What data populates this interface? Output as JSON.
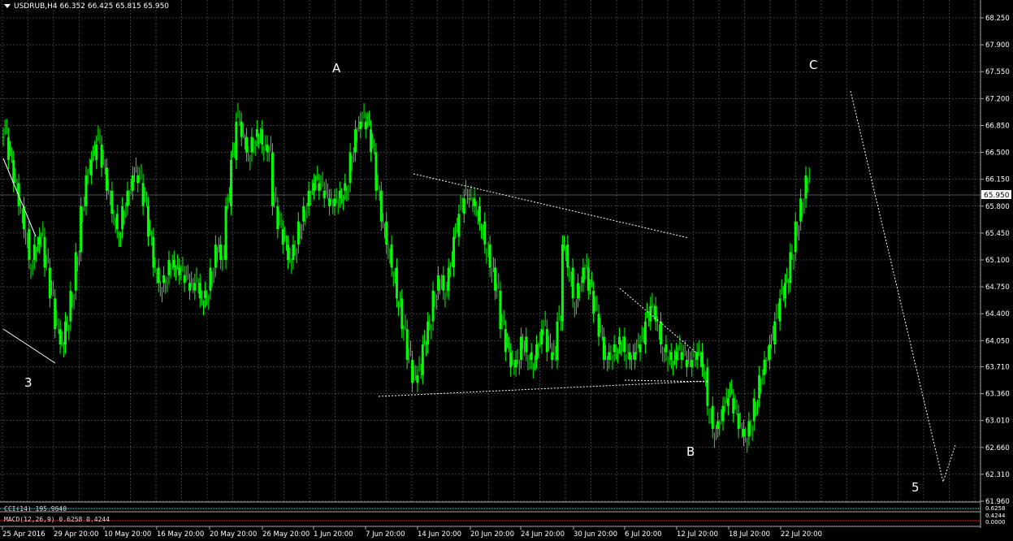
{
  "header": {
    "symbol": "USDRUB,H4",
    "ohlc": "66.352 66.425 65.815 65.950"
  },
  "indicators": {
    "cci": "CCI(14) 195.9640",
    "macd": "MACD(12,26,9) 0.6258 0.4244"
  },
  "colors": {
    "background": "#000000",
    "grid": "#8a8a8a",
    "candle": "#00ff00",
    "text": "#ffffff",
    "current_price_box": "#ffffff"
  },
  "chart_data": {
    "type": "line",
    "title": "USDRUB,H4",
    "price_axis_ticks": [
      "68.250",
      "67.900",
      "67.550",
      "67.200",
      "66.850",
      "66.500",
      "66.150",
      "65.800",
      "65.450",
      "65.100",
      "64.750",
      "64.400",
      "64.050",
      "63.710",
      "63.360",
      "63.010",
      "62.660",
      "62.310",
      "61.960"
    ],
    "ylim": [
      61.96,
      68.25
    ],
    "current_price": "65.950",
    "time_axis_ticks": [
      "25 Apr 2016",
      "29 Apr 20:00",
      "10 May 20:00",
      "16 May 20:00",
      "20 May 20:00",
      "26 May 20:00",
      "1 Jun 20:00",
      "7 Jun 20:00",
      "14 Jun 20:00",
      "20 Jun 20:00",
      "24 Jun 20:00",
      "30 Jun 20:00",
      "6 Jul 20:00",
      "12 Jul 20:00",
      "18 Jul 20:00",
      "22 Jul 20:00"
    ],
    "wave_labels": [
      {
        "text": "3",
        "x": "25 Apr 2016",
        "y": 63.9
      },
      {
        "text": "A",
        "x": "1 Jun 20:00",
        "y": 67.65
      },
      {
        "text": "B",
        "x": "12 Jul 20:00",
        "y": 62.7
      },
      {
        "text": "C",
        "x": "22 Jul 20:00",
        "y": 67.65
      },
      {
        "text": "5",
        "x": "after 22 Jul",
        "y": 62.1
      }
    ],
    "series": [
      {
        "values": [
          66.7,
          66.4,
          66.1,
          65.8,
          65.5,
          65.1,
          65.3,
          65.4,
          65.0,
          64.6,
          64.2,
          64.0,
          64.3,
          64.7,
          65.2,
          65.8,
          66.2,
          66.4,
          66.6,
          66.3,
          66.0,
          65.7,
          65.5,
          65.8,
          66.0,
          66.2,
          66.1,
          65.8,
          65.4,
          65.0,
          64.8,
          64.9,
          65.1,
          65.0,
          64.9,
          64.8,
          64.7,
          64.8,
          64.6,
          64.7,
          65.0,
          65.3,
          65.1,
          65.8,
          66.4,
          66.9,
          66.7,
          66.5,
          66.7,
          66.8,
          66.6,
          66.5,
          65.8,
          65.5,
          65.3,
          65.1,
          65.3,
          65.6,
          65.8,
          66.0,
          66.1,
          66.0,
          65.9,
          65.8,
          65.9,
          66.0,
          66.1,
          66.5,
          66.8,
          66.9,
          66.8,
          66.5,
          66.0,
          65.6,
          65.3,
          65.0,
          64.6,
          64.2,
          63.8,
          63.5,
          63.6,
          64.0,
          64.3,
          64.7,
          64.9,
          64.7,
          65.0,
          65.4,
          65.7,
          65.9,
          65.9,
          65.8,
          65.6,
          65.3,
          65.0,
          64.7,
          64.2,
          63.9,
          63.7,
          63.8,
          64.1,
          63.9,
          63.8,
          64.0,
          64.2,
          63.9,
          63.8,
          64.3,
          65.3,
          65.0,
          64.6,
          64.8,
          65.0,
          64.7,
          64.4,
          64.1,
          63.8,
          63.9,
          64.0,
          64.1,
          63.9,
          63.8,
          63.9,
          64.0,
          64.3,
          64.5,
          64.3,
          64.0,
          63.9,
          63.8,
          63.9,
          63.8,
          63.7,
          63.8,
          63.9,
          63.7,
          63.2,
          62.9,
          63.0,
          63.2,
          63.3,
          63.1,
          62.9,
          62.8,
          63.0,
          63.3,
          63.6,
          63.8,
          64.0,
          64.3,
          64.6,
          64.8,
          65.2,
          65.6,
          65.9,
          66.2
        ]
      }
    ],
    "grid": true
  }
}
